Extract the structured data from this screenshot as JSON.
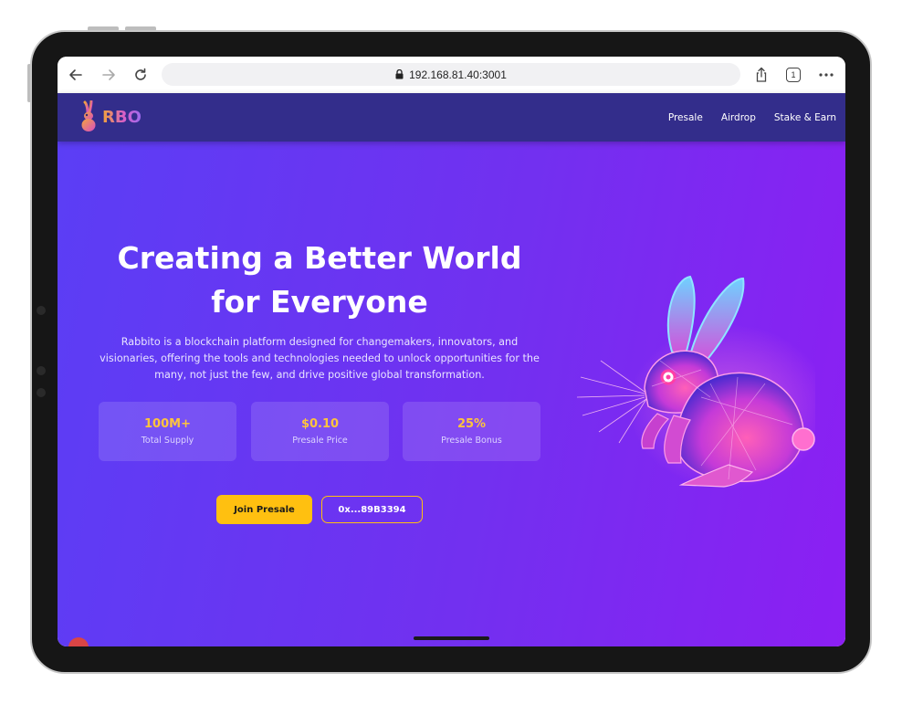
{
  "browser": {
    "url": "192.168.81.40:3001",
    "tab_count": "1"
  },
  "header": {
    "logo_text": "RBO",
    "nav": [
      "Presale",
      "Airdrop",
      "Stake & Earn"
    ]
  },
  "hero": {
    "title_line1": "Creating a Better World",
    "title_line2": "for Everyone",
    "description": "Rabbito is a blockchain platform designed for changemakers, innovators, and visionaries, offering the tools and technologies needed to unlock opportunities for the many, not just the few, and drive positive global transformation.",
    "stats": [
      {
        "value": "100M+",
        "label": "Total Supply"
      },
      {
        "value": "$0.10",
        "label": "Presale Price"
      },
      {
        "value": "25%",
        "label": "Presale Bonus"
      }
    ],
    "cta_primary": "Join Presale",
    "cta_wallet": "0x...89B3394"
  },
  "colors": {
    "header_bg": "#332d8b",
    "hero_gradient_start": "#5b3ef5",
    "hero_gradient_end": "#8c1ff3",
    "accent": "#ffc010"
  },
  "icons": {
    "back": "arrow-left-icon",
    "forward": "arrow-right-icon",
    "reload": "reload-icon",
    "lock": "lock-icon",
    "share": "share-icon",
    "tabs": "tabs-icon",
    "more": "more-dots-icon",
    "logo": "rabbit-logo-icon"
  }
}
